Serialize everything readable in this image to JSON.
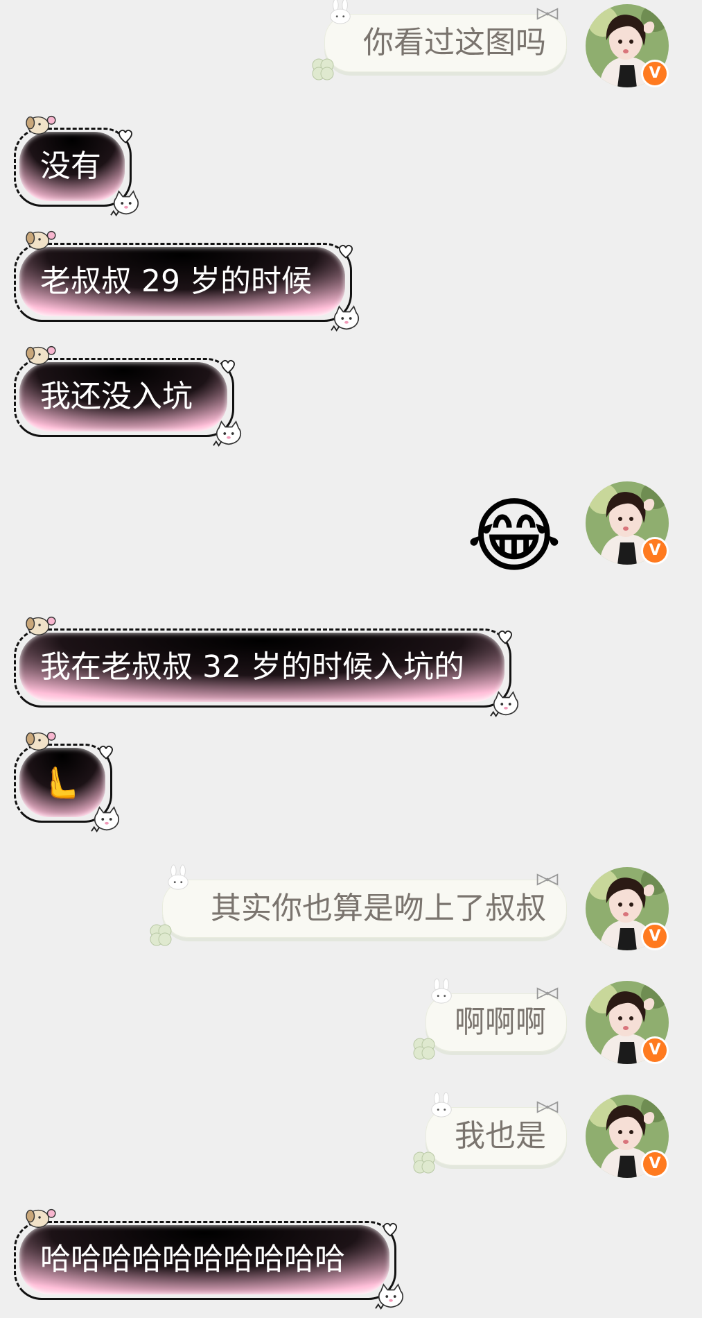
{
  "messages": [
    {
      "side": "right",
      "text": "你看过这图吗"
    },
    {
      "side": "left",
      "text": "没有"
    },
    {
      "side": "left",
      "text": "老叔叔 29 岁的时候"
    },
    {
      "side": "left",
      "text": "我还没入坑"
    },
    {
      "side": "right",
      "emoji": "😂"
    },
    {
      "side": "left",
      "text": "我在老叔叔 32 岁的时候入坑的"
    },
    {
      "side": "left",
      "emoji": "🫷"
    },
    {
      "side": "right",
      "text": "其实你也算是吻上了叔叔"
    },
    {
      "side": "right",
      "text": "啊啊啊"
    },
    {
      "side": "right",
      "text": "我也是"
    },
    {
      "side": "left",
      "text": "哈哈哈哈哈哈哈哈哈哈"
    }
  ],
  "avatar": {
    "badge": "V"
  },
  "colors": {
    "background": "#efefef",
    "badge": "#ff7a1f",
    "sent_text": "#7a746e",
    "received_text": "#ffffff"
  }
}
